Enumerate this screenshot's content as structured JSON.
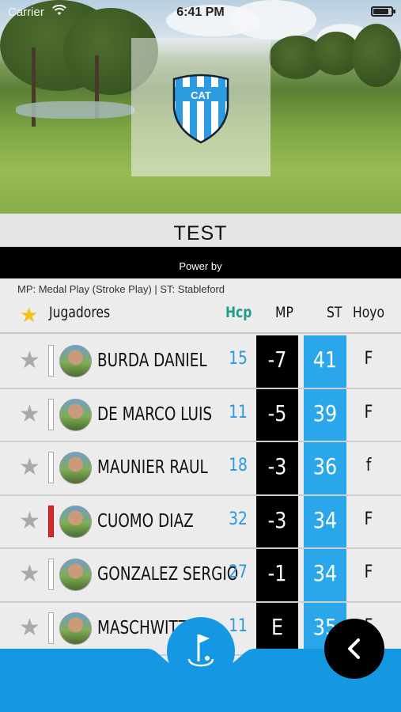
{
  "status_bar": {
    "carrier": "Carrier",
    "time": "6:41 PM",
    "battery_level": 0.85
  },
  "hero": {
    "logo_text": "CAT"
  },
  "event": {
    "title": "TEST",
    "power_by": "Power by"
  },
  "legend": "MP: Medal Play (Stroke Play) | ST: Stableford",
  "table": {
    "headers": {
      "players": "Jugadores",
      "hcp": "Hcp",
      "mp": "MP",
      "st": "ST",
      "hoyo": "Hoyo"
    },
    "rows": [
      {
        "name": "BURDA DANIEL",
        "hcp": "15",
        "mp": "-7",
        "st": "41",
        "hoyo": "F",
        "flag": "white"
      },
      {
        "name": "DE MARCO LUIS",
        "hcp": "11",
        "mp": "-5",
        "st": "39",
        "hoyo": "F",
        "flag": "white"
      },
      {
        "name": "MAUNIER RAUL",
        "hcp": "18",
        "mp": "-3",
        "st": "36",
        "hoyo": "f",
        "flag": "white"
      },
      {
        "name": "CUOMO DIAZ",
        "hcp": "32",
        "mp": "-3",
        "st": "34",
        "hoyo": "F",
        "flag": "red"
      },
      {
        "name": "GONZALEZ SERGIO",
        "hcp": "27",
        "mp": "-1",
        "st": "34",
        "hoyo": "F",
        "flag": "white"
      },
      {
        "name": "MASCHWITZ",
        "hcp": "11",
        "mp": "E",
        "st": "35",
        "hoyo": "F",
        "flag": "white"
      }
    ]
  },
  "icons": {
    "favorite": "star-icon",
    "golf": "golf-flag-icon",
    "back": "chevron-left-icon"
  },
  "colors": {
    "accent_blue": "#2aa6ea",
    "hcp_header": "#1e9e8c",
    "mp_column": "#000000",
    "star_gold": "#f2c316"
  }
}
